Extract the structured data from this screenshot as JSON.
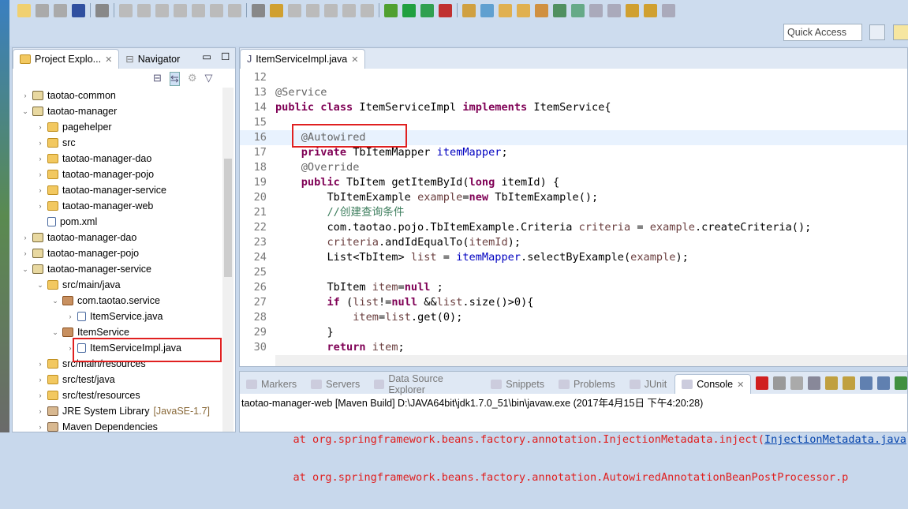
{
  "toolbar": {
    "quick_access": "Quick Access"
  },
  "explorer": {
    "tabs": [
      {
        "label": "Project Explo..."
      },
      {
        "label": "Navigator"
      }
    ],
    "items": [
      {
        "label": "taotao-common",
        "depth": 0,
        "icon": "project",
        "arrow": "›"
      },
      {
        "label": "taotao-manager",
        "depth": 0,
        "icon": "project",
        "arrow": "⌄"
      },
      {
        "label": "pagehelper",
        "depth": 1,
        "icon": "folder",
        "arrow": "›"
      },
      {
        "label": "src",
        "depth": 1,
        "icon": "folder",
        "arrow": "›"
      },
      {
        "label": "taotao-manager-dao",
        "depth": 1,
        "icon": "folder",
        "arrow": "›"
      },
      {
        "label": "taotao-manager-pojo",
        "depth": 1,
        "icon": "folder",
        "arrow": "›"
      },
      {
        "label": "taotao-manager-service",
        "depth": 1,
        "icon": "folder",
        "arrow": "›"
      },
      {
        "label": "taotao-manager-web",
        "depth": 1,
        "icon": "folder",
        "arrow": "›"
      },
      {
        "label": "pom.xml",
        "depth": 1,
        "icon": "file",
        "arrow": ""
      },
      {
        "label": "taotao-manager-dao",
        "depth": 0,
        "icon": "project",
        "arrow": "›"
      },
      {
        "label": "taotao-manager-pojo",
        "depth": 0,
        "icon": "project",
        "arrow": "›"
      },
      {
        "label": "taotao-manager-service",
        "depth": 0,
        "icon": "project",
        "arrow": "⌄"
      },
      {
        "label": "src/main/java",
        "depth": 1,
        "icon": "folder",
        "arrow": "⌄"
      },
      {
        "label": "com.taotao.service",
        "depth": 2,
        "icon": "package",
        "arrow": "⌄"
      },
      {
        "label": "ItemService.java",
        "depth": 3,
        "icon": "file",
        "arrow": "›"
      },
      {
        "label": "ItemService",
        "depth": 2,
        "icon": "package",
        "arrow": "⌄"
      },
      {
        "label": "ItemServiceImpl.java",
        "depth": 3,
        "icon": "file",
        "arrow": "›"
      },
      {
        "label": "src/main/resources",
        "depth": 1,
        "icon": "folder",
        "arrow": "›"
      },
      {
        "label": "src/test/java",
        "depth": 1,
        "icon": "folder",
        "arrow": "›"
      },
      {
        "label": "src/test/resources",
        "depth": 1,
        "icon": "folder",
        "arrow": "›"
      },
      {
        "label": "JRE System Library",
        "extra": "[JavaSE-1.7]",
        "depth": 1,
        "icon": "jar",
        "arrow": "›"
      },
      {
        "label": "Maven Dependencies",
        "depth": 1,
        "icon": "jar",
        "arrow": "›"
      }
    ]
  },
  "editor": {
    "tab": "ItemServiceImpl.java",
    "lines": [
      {
        "n": "12",
        "t": []
      },
      {
        "n": "13",
        "t": [
          [
            "an",
            "@Service"
          ]
        ]
      },
      {
        "n": "14",
        "t": [
          [
            "kw",
            "public class"
          ],
          [
            "",
            "ItemServiceImpl "
          ],
          [
            "kw",
            "implements"
          ],
          [
            "",
            "ItemService{"
          ]
        ]
      },
      {
        "n": "15",
        "t": []
      },
      {
        "n": "16",
        "t": [
          [
            "",
            "    "
          ],
          [
            "an",
            "@Autowired"
          ]
        ],
        "hl": true
      },
      {
        "n": "17",
        "t": [
          [
            "",
            "    "
          ],
          [
            "kw",
            "private"
          ],
          [
            "",
            "TbItemMapper "
          ],
          [
            "fd",
            "itemMapper"
          ],
          [
            "",
            ";"
          ]
        ]
      },
      {
        "n": "18",
        "t": [
          [
            "",
            "    "
          ],
          [
            "an",
            "@Override"
          ]
        ]
      },
      {
        "n": "19",
        "t": [
          [
            "",
            "    "
          ],
          [
            "kw",
            "public"
          ],
          [
            "",
            "TbItem getItemById("
          ],
          [
            "kw",
            "long"
          ],
          [
            "",
            "itemId) {"
          ]
        ]
      },
      {
        "n": "20",
        "t": [
          [
            "",
            "        TbItemExample "
          ],
          [
            "lv",
            "example"
          ],
          [
            "",
            "="
          ],
          [
            "kw",
            "new"
          ],
          [
            "",
            "TbItemExample();"
          ]
        ]
      },
      {
        "n": "21",
        "t": [
          [
            "",
            "        "
          ],
          [
            "cm",
            "//创建查询条件"
          ]
        ]
      },
      {
        "n": "22",
        "t": [
          [
            "",
            "        com.taotao.pojo.TbItemExample.Criteria "
          ],
          [
            "lv",
            "criteria"
          ],
          [
            "",
            " = "
          ],
          [
            "lv",
            "example"
          ],
          [
            "",
            ".createCriteria();"
          ]
        ]
      },
      {
        "n": "23",
        "t": [
          [
            "",
            "        "
          ],
          [
            "lv",
            "criteria"
          ],
          [
            "",
            ".andIdEqualTo("
          ],
          [
            "lv",
            "itemId"
          ],
          [
            "",
            ");"
          ]
        ]
      },
      {
        "n": "24",
        "t": [
          [
            "",
            "        List<TbItem> "
          ],
          [
            "lv",
            "list"
          ],
          [
            "",
            " = "
          ],
          [
            "fd",
            "itemMapper"
          ],
          [
            "",
            ".selectByExample("
          ],
          [
            "lv",
            "example"
          ],
          [
            "",
            ");"
          ]
        ]
      },
      {
        "n": "25",
        "t": []
      },
      {
        "n": "26",
        "t": [
          [
            "",
            "        TbItem "
          ],
          [
            "lv",
            "item"
          ],
          [
            "",
            "="
          ],
          [
            "kw",
            "null"
          ],
          [
            "",
            ";"
          ]
        ]
      },
      {
        "n": "27",
        "t": [
          [
            "",
            "        "
          ],
          [
            "kw",
            "if"
          ],
          [
            "",
            "("
          ],
          [
            "lv",
            "list"
          ],
          [
            "",
            "!="
          ],
          [
            "kw",
            "null"
          ],
          [
            "",
            "&&"
          ],
          [
            "lv",
            "list"
          ],
          [
            "",
            ".size()>0){"
          ]
        ]
      },
      {
        "n": "28",
        "t": [
          [
            "",
            "            "
          ],
          [
            "lv",
            "item"
          ],
          [
            "",
            "="
          ],
          [
            "lv",
            "list"
          ],
          [
            "",
            ".get(0);"
          ]
        ]
      },
      {
        "n": "29",
        "t": [
          [
            "",
            "        }"
          ]
        ]
      },
      {
        "n": "30",
        "t": [
          [
            "",
            "        "
          ],
          [
            "kw",
            "return"
          ],
          [
            "lv",
            "item"
          ],
          [
            "",
            ";"
          ]
        ]
      }
    ]
  },
  "bottom": {
    "tabs": [
      "Markers",
      "Servers",
      "Data Source Explorer",
      "Snippets",
      "Problems",
      "JUnit",
      "Console"
    ],
    "header": "taotao-manager-web [Maven Build] D:\\JAVA64bit\\jdk1.7.0_51\\bin\\javaw.exe (2017年4月15日 下午4:20:28)",
    "lines": [
      {
        "text": "        at org.springframework.beans.factory.annotation.InjectionMetadata.inject(",
        "link": "InjectionMetadata.java"
      },
      {
        "text": "        at org.springframework.beans.factory.annotation.AutowiredAnnotationBeanPostProcessor.p",
        "link": ""
      }
    ]
  }
}
